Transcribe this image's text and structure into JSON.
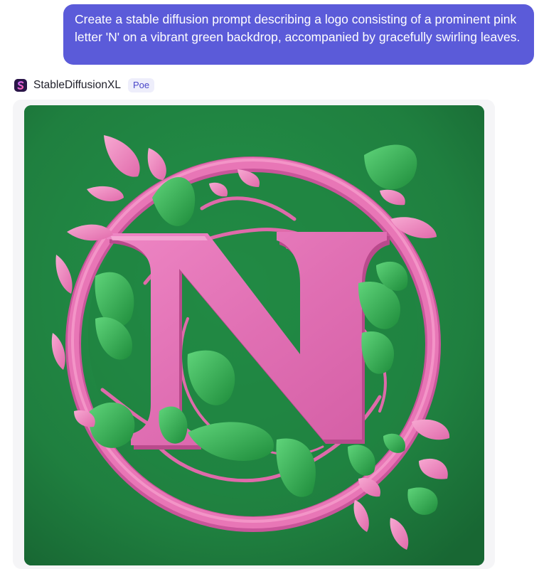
{
  "conversation": {
    "user_message": "Create a stable diffusion prompt describing a logo consisting of a prominent pink letter 'N' on a vibrant green backdrop, accompanied by gracefully swirling leaves.",
    "bot": {
      "name": "StableDiffusionXL",
      "badge": "Poe",
      "avatar_icon": "stable-diffusion-s-icon"
    },
    "generated_image": {
      "letter": "N",
      "colors": {
        "background": "#1f7a3c",
        "letter": "#e070b0",
        "ring": "#e46cae",
        "leaf_green": "#2fae4d",
        "leaf_pink": "#ee7fb9"
      }
    }
  }
}
